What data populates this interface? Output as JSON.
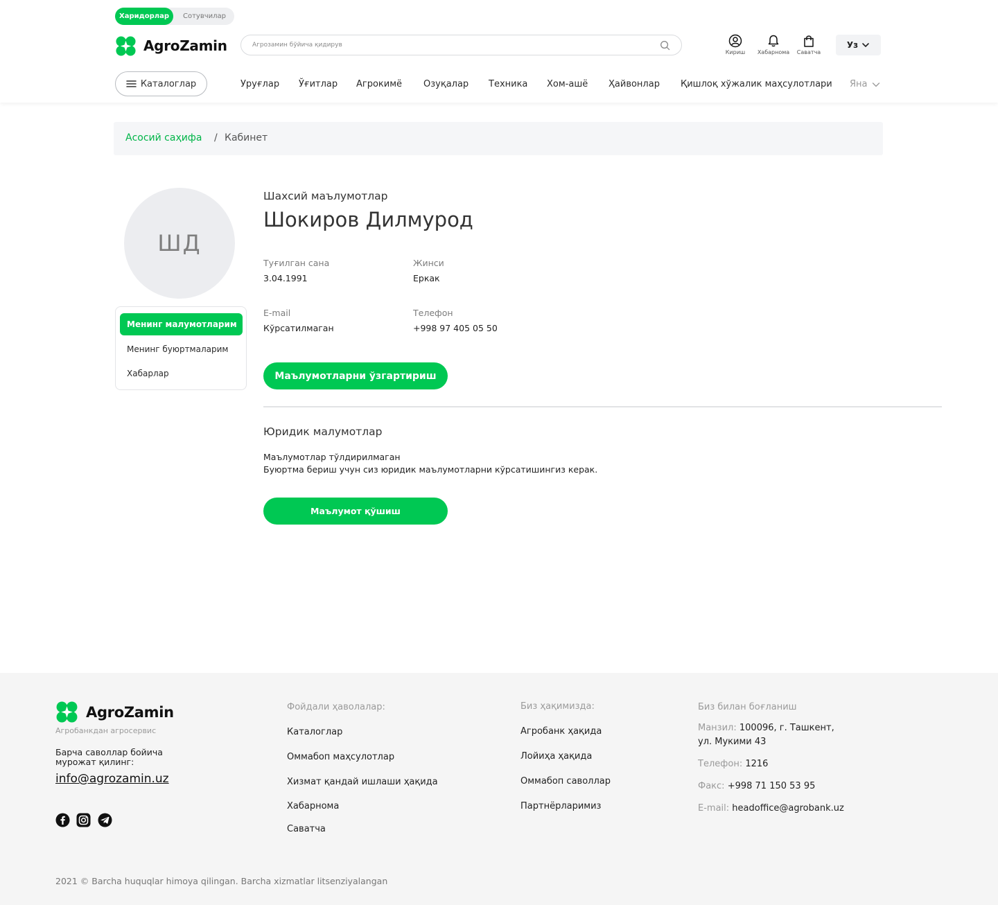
{
  "header": {
    "roles": {
      "active": "Харидорлар",
      "inactive": "Сотувчилар"
    },
    "brand": "AgroZamin",
    "search_placeholder": "Агрозамин бўйича қидирув",
    "icons": {
      "login": "Кириш",
      "notifications": "Хабарнома",
      "cart": "Саватча"
    },
    "language": "Уз",
    "catalog_button": "Каталоглар",
    "nav": [
      "Уруғлар",
      "Ўғитлар",
      "Агрокимё",
      "Озуқалар",
      "Техника",
      "Хом-ашё",
      "Ҳайвонлар",
      "Қишлоқ хўжалик маҳсулотлари"
    ],
    "nav_more": "Яна"
  },
  "breadcrumb": {
    "home": "Асосий саҳифа",
    "separator": "/",
    "current": "Кабинет"
  },
  "sidebar": {
    "avatar_initials": "ШД",
    "menu": [
      "Менинг малумотларим",
      "Менинг буюртмаларим",
      "Хабарлар"
    ]
  },
  "profile": {
    "section_title": "Шахсий маълумотлар",
    "full_name": "Шокиров Дилмурод",
    "birth_label": "Туғилган сана",
    "birth_value": "3.04.1991",
    "gender_label": "Жинси",
    "gender_value": "Еркак",
    "email_label": "E-mail",
    "email_value": "Кўрсатилмаган",
    "phone_label": "Телефон",
    "phone_value": "+998 97 405 05 50",
    "edit_button": "Маълумотларни ўзгартириш"
  },
  "legal": {
    "title": "Юридик малумотлар",
    "line1": "Маълумотлар тўлдирилмаган",
    "line2": "Буюртма бериш учун сиз юридик маълумотларни кўрсатишингиз керак.",
    "add_button": "Маълумот қўшиш"
  },
  "footer": {
    "brand": "AgroZamin",
    "tagline": "Агробанкдан агросервис",
    "ask": "Барча саволлар бойича мурожат қилинг:",
    "email": "info@agrozamin.uz",
    "useful_title": "Фойдали ҳаволалар:",
    "useful_links": [
      "Каталоглар",
      "Оммабоп маҳсулотлар",
      "Хизмат қандай ишлаши ҳақида",
      "Хабарнома",
      "Саватча"
    ],
    "about_title": "Биз ҳақимизда:",
    "about_links": [
      "Агробанк ҳақида",
      "Лойиҳа ҳақида",
      "Оммабоп саволлар",
      "Партнёрларимиз"
    ],
    "contact_title": "Биз билан боғланиш",
    "address_label": "Манзил:",
    "address_value": "100096, г. Ташкент,",
    "address_value2": "ул. Мукими 43",
    "phone_label": "Телефон:",
    "phone_value": "1216",
    "fax_label": "Факс:",
    "fax_value": "+998 71 150 53 95",
    "email_label": "E-mail:",
    "email_value": "headoffice@agrobank.uz",
    "copyright": "2021 © Barcha huquqlar himoya qilingan. Barcha xizmatlar litsenziyalangan"
  },
  "colors": {
    "accent": "#00c853",
    "accent_text": "#00b548",
    "footer_bg": "#f5f5f5",
    "breadcrumb_bg": "#f5f6f8"
  }
}
